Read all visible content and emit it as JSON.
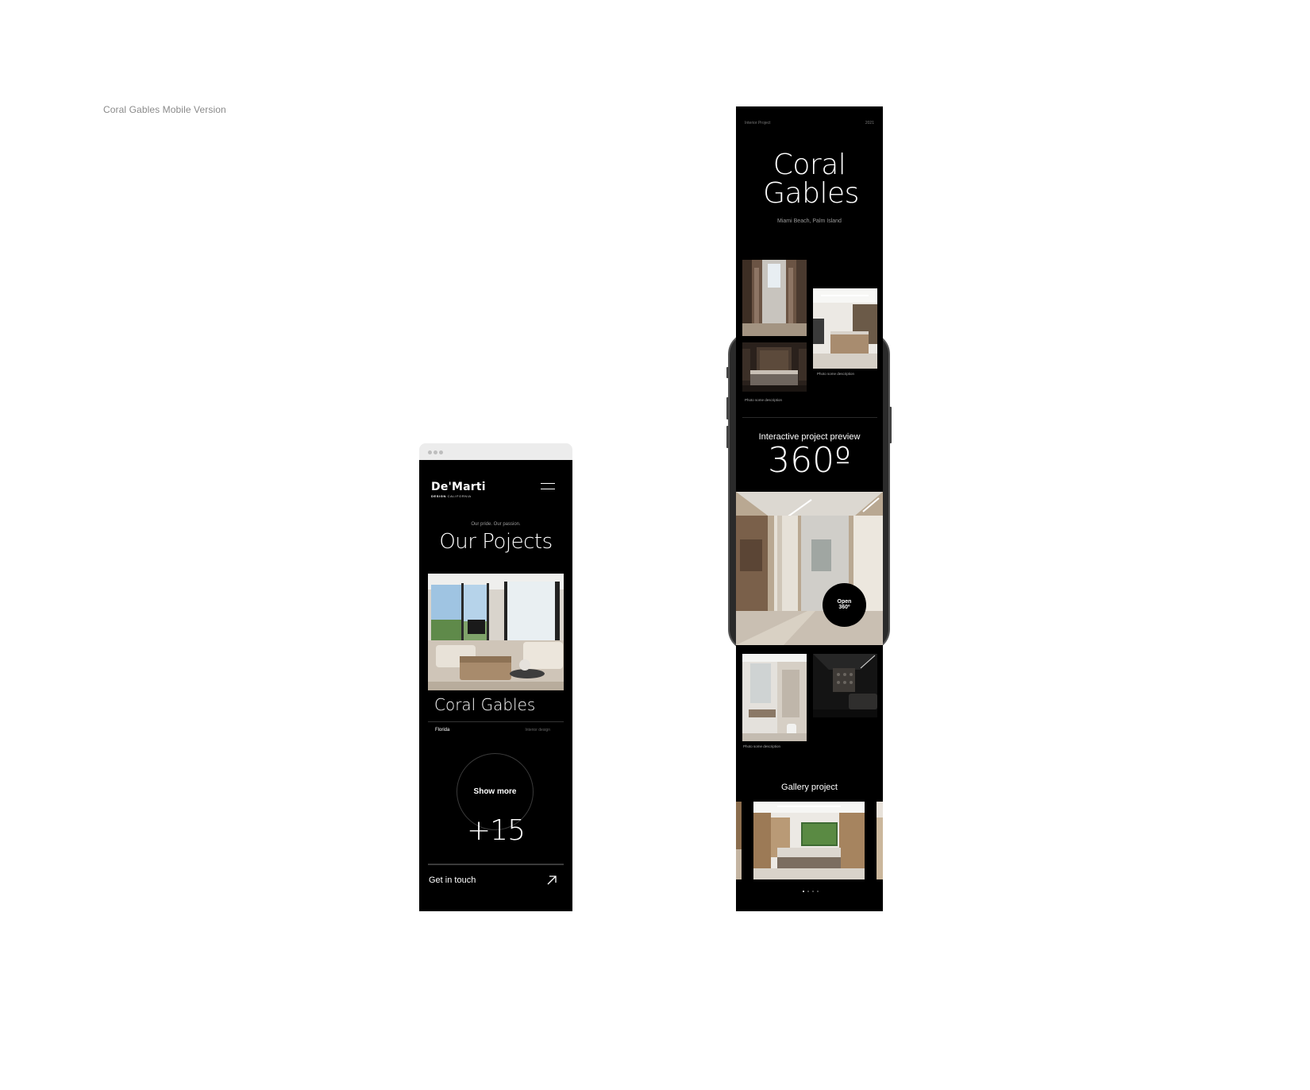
{
  "page": {
    "caption": "Coral Gables Mobile Version"
  },
  "left_mock": {
    "logo": {
      "name": "De'Marti",
      "sub_bold": "DESIGN",
      "sub_rest": "CALIFORNIA"
    },
    "tagline": "Our pride. Our passion.",
    "title": "Our Pojects",
    "project_name": "Coral Gables",
    "location": "Florida",
    "category": "Interior design",
    "show_more": "Show more",
    "count": "+15",
    "cta": "Get in touch",
    "icons": {
      "menu": "hamburger-menu-icon",
      "arrow": "arrow-up-right-icon"
    }
  },
  "right_mock": {
    "top_left_label": "Interior Project",
    "top_right_label": "2021",
    "title_line1": "Coral",
    "title_line2": "Gables",
    "subtitle": "Miami Beach, Palm Island",
    "caption_1": "Photo some description",
    "caption_2": "Photo some description",
    "caption_3": "Photo some description",
    "preview_label": "Interactive project preview",
    "degrees": "360º",
    "open_line1": "Open",
    "open_line2": "360º",
    "gallery_label": "Gallery project"
  },
  "colors": {
    "screen_bg": "#000000",
    "page_bg": "#ffffff",
    "caption": "#8a8a8a"
  }
}
